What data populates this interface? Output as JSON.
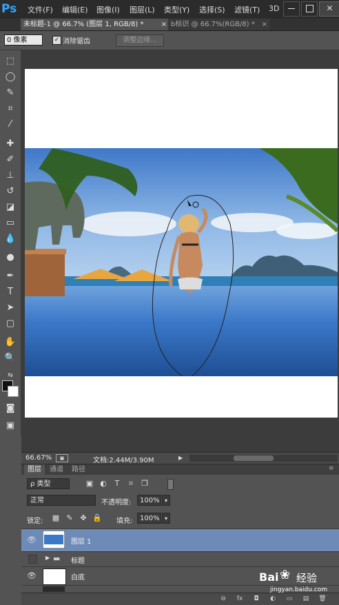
{
  "app": {
    "logo": "Ps"
  },
  "menu": [
    "文件(F)",
    "编辑(E)",
    "图像(I)",
    "图层(L)",
    "类型(Y)",
    "选择(S)",
    "滤镜(T)",
    "3D"
  ],
  "window_controls": {
    "close_label": "✕"
  },
  "tabs": [
    {
      "label": "未标题-1 @ 66.7% (图层 1, RGB/8) *",
      "close": "×",
      "active": true
    },
    {
      "label": "b标识 @ 66.7%(RGB/8) *",
      "close": "×",
      "active": false
    }
  ],
  "options": {
    "feather_value": "0 像素",
    "antialias_checked": true,
    "antialias_label": "消除锯齿",
    "refine_edge_label": "调整边缘..."
  },
  "tools": {
    "icons": [
      "marquee-icon",
      "lasso-icon",
      "quick-select-icon",
      "crop-icon",
      "eyedropper-icon",
      "healing-brush-icon",
      "brush-icon",
      "clone-stamp-icon",
      "history-brush-icon",
      "eraser-icon",
      "gradient-icon",
      "blur-icon",
      "dodge-icon",
      "pen-icon",
      "type-icon",
      "path-select-icon",
      "shape-icon",
      "hand-icon",
      "zoom-icon"
    ],
    "glyphs": [
      "⬚",
      "◯",
      "✎",
      "⌗",
      "⁄",
      "✚",
      "✐",
      "⊥",
      "↺",
      "◪",
      "▭",
      "💧",
      "●",
      "✒",
      "T",
      "➤",
      "▢",
      "✋",
      "🔍"
    ],
    "fg_color": "#111111",
    "bg_color": "#ffffff",
    "quick_mask_glyph": "◙",
    "screen_mode_glyph": "▣"
  },
  "status": {
    "zoom": "66.67%",
    "doc": "文档:2.44M/3.90M",
    "arrow": "▶"
  },
  "layers_panel": {
    "tabs": [
      "图层",
      "通道",
      "路径"
    ],
    "filter_label": "ρ 类型",
    "filter_icons": [
      "▣",
      "◐",
      "T",
      "⌗",
      "❐"
    ],
    "blend_mode": "正常",
    "opacity_label": "不透明度:",
    "opacity_value": "100%",
    "lock_label": "锁定:",
    "lock_icons": [
      "▦",
      "✎",
      "✥",
      "🔒"
    ],
    "fill_label": "填充:",
    "fill_value": "100%",
    "arrow": "▾",
    "layers": [
      {
        "name": "图层 1",
        "visible": true,
        "selected": true,
        "type": "image"
      },
      {
        "name": "标题",
        "visible": false,
        "selected": false,
        "type": "group"
      },
      {
        "name": "白底",
        "visible": true,
        "selected": false,
        "type": "fill"
      }
    ],
    "footer_icons": [
      "⊖",
      "fx",
      "◘",
      "◐",
      "▭",
      "▤",
      "🗑"
    ]
  },
  "watermark": {
    "brand": "Bai",
    "brand2": "经验",
    "url": "jingyan.baidu.com"
  }
}
